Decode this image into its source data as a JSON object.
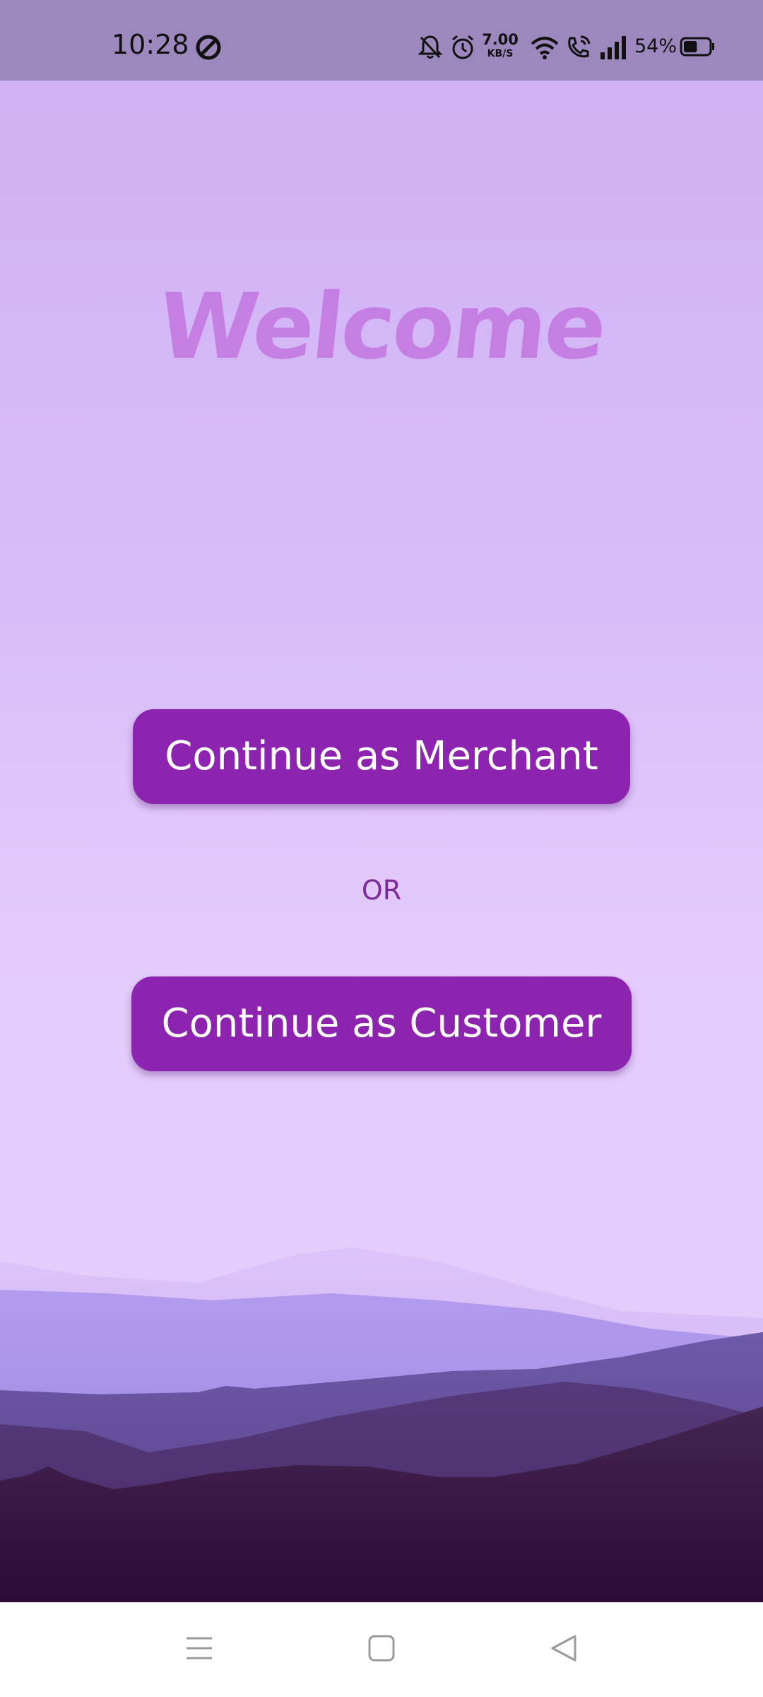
{
  "status_bar": {
    "time": "10:28",
    "net_speed_value": "7.00",
    "net_speed_unit": "KB/S",
    "battery_percent": "54%",
    "battery_level": 0.54,
    "icons": [
      "do-not-disturb-icon",
      "bell-off-icon",
      "alarm-icon",
      "wifi-icon",
      "wifi-calling-icon",
      "signal-icon",
      "battery-icon"
    ]
  },
  "main": {
    "title": "Welcome",
    "merchant_button_label": "Continue as Merchant",
    "or_label": "OR",
    "customer_button_label": "Continue as Customer"
  },
  "nav_bar": {
    "icons": [
      "menu-icon",
      "home-icon",
      "back-icon"
    ]
  },
  "colors": {
    "status_bar_bg": "#9c88bd",
    "background_top": "#d1b2f4",
    "background_bottom": "#e4ccfb",
    "title": "#c57fe2",
    "button_bg": "#8c24b0",
    "button_text": "#ffffff",
    "or_text": "#7b2a9c"
  }
}
